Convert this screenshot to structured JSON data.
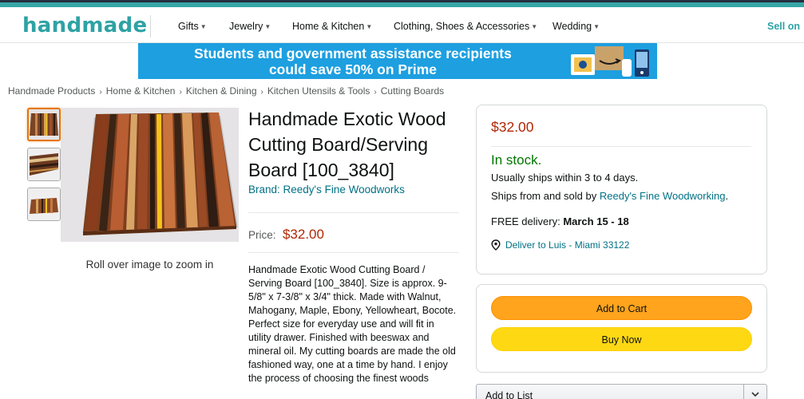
{
  "header": {
    "logo": "handmade",
    "nav": [
      {
        "label": "Gifts"
      },
      {
        "label": "Jewelry"
      },
      {
        "label": "Home & Kitchen"
      },
      {
        "label": "Clothing, Shoes & Accessories"
      },
      {
        "label": "Wedding"
      }
    ],
    "sell_on": "Sell on"
  },
  "banner": {
    "line1": "Students and government assistance recipients",
    "line2": "could save 50% on Prime"
  },
  "breadcrumb": [
    "Handmade Products",
    "Home & Kitchen",
    "Kitchen & Dining",
    "Kitchen Utensils & Tools",
    "Cutting Boards"
  ],
  "product": {
    "title": "Handmade Exotic Wood Cutting Board/Serving Board [100_3840]",
    "brand": "Brand: Reedy's Fine Woodworks",
    "price_label": "Price:",
    "price": "$32.00",
    "zoom_hint": "Roll over image to zoom in",
    "description": "Handmade Exotic Wood Cutting Board / Serving Board [100_3840]. Size is approx. 9-5/8\" x 7-3/8\" x 3/4\" thick. Made with Walnut, Mahogany, Maple, Ebony, Yellowheart, Bocote. Perfect size for everyday use and will fit in utility drawer. Finished with beeswax and mineral oil. My cutting boards are made the old fashioned way, one at a time by hand. I enjoy the process of choosing the finest woods"
  },
  "buybox": {
    "price": "$32.00",
    "stock": "In stock.",
    "ships": "Usually ships within 3 to 4 days.",
    "sold_by_prefix": "Ships from and sold by ",
    "sold_by_link": "Reedy's Fine Woodworking",
    "sold_by_suffix": ".",
    "delivery_prefix": "FREE delivery: ",
    "delivery_date": "March 15 - 18",
    "deliver_to": "Deliver to Luis - Miami 33122"
  },
  "actions": {
    "add_to_cart": "Add to Cart",
    "buy_now": "Buy Now",
    "add_to_list": "Add to List"
  },
  "colors": {
    "brand_teal": "#2fa2a4",
    "price_red": "#b12704",
    "stock_green": "#007600",
    "link": "#007185",
    "cart_button": "#ffa41c",
    "buy_button": "#ffd814",
    "banner_blue": "#1d9fe0"
  }
}
